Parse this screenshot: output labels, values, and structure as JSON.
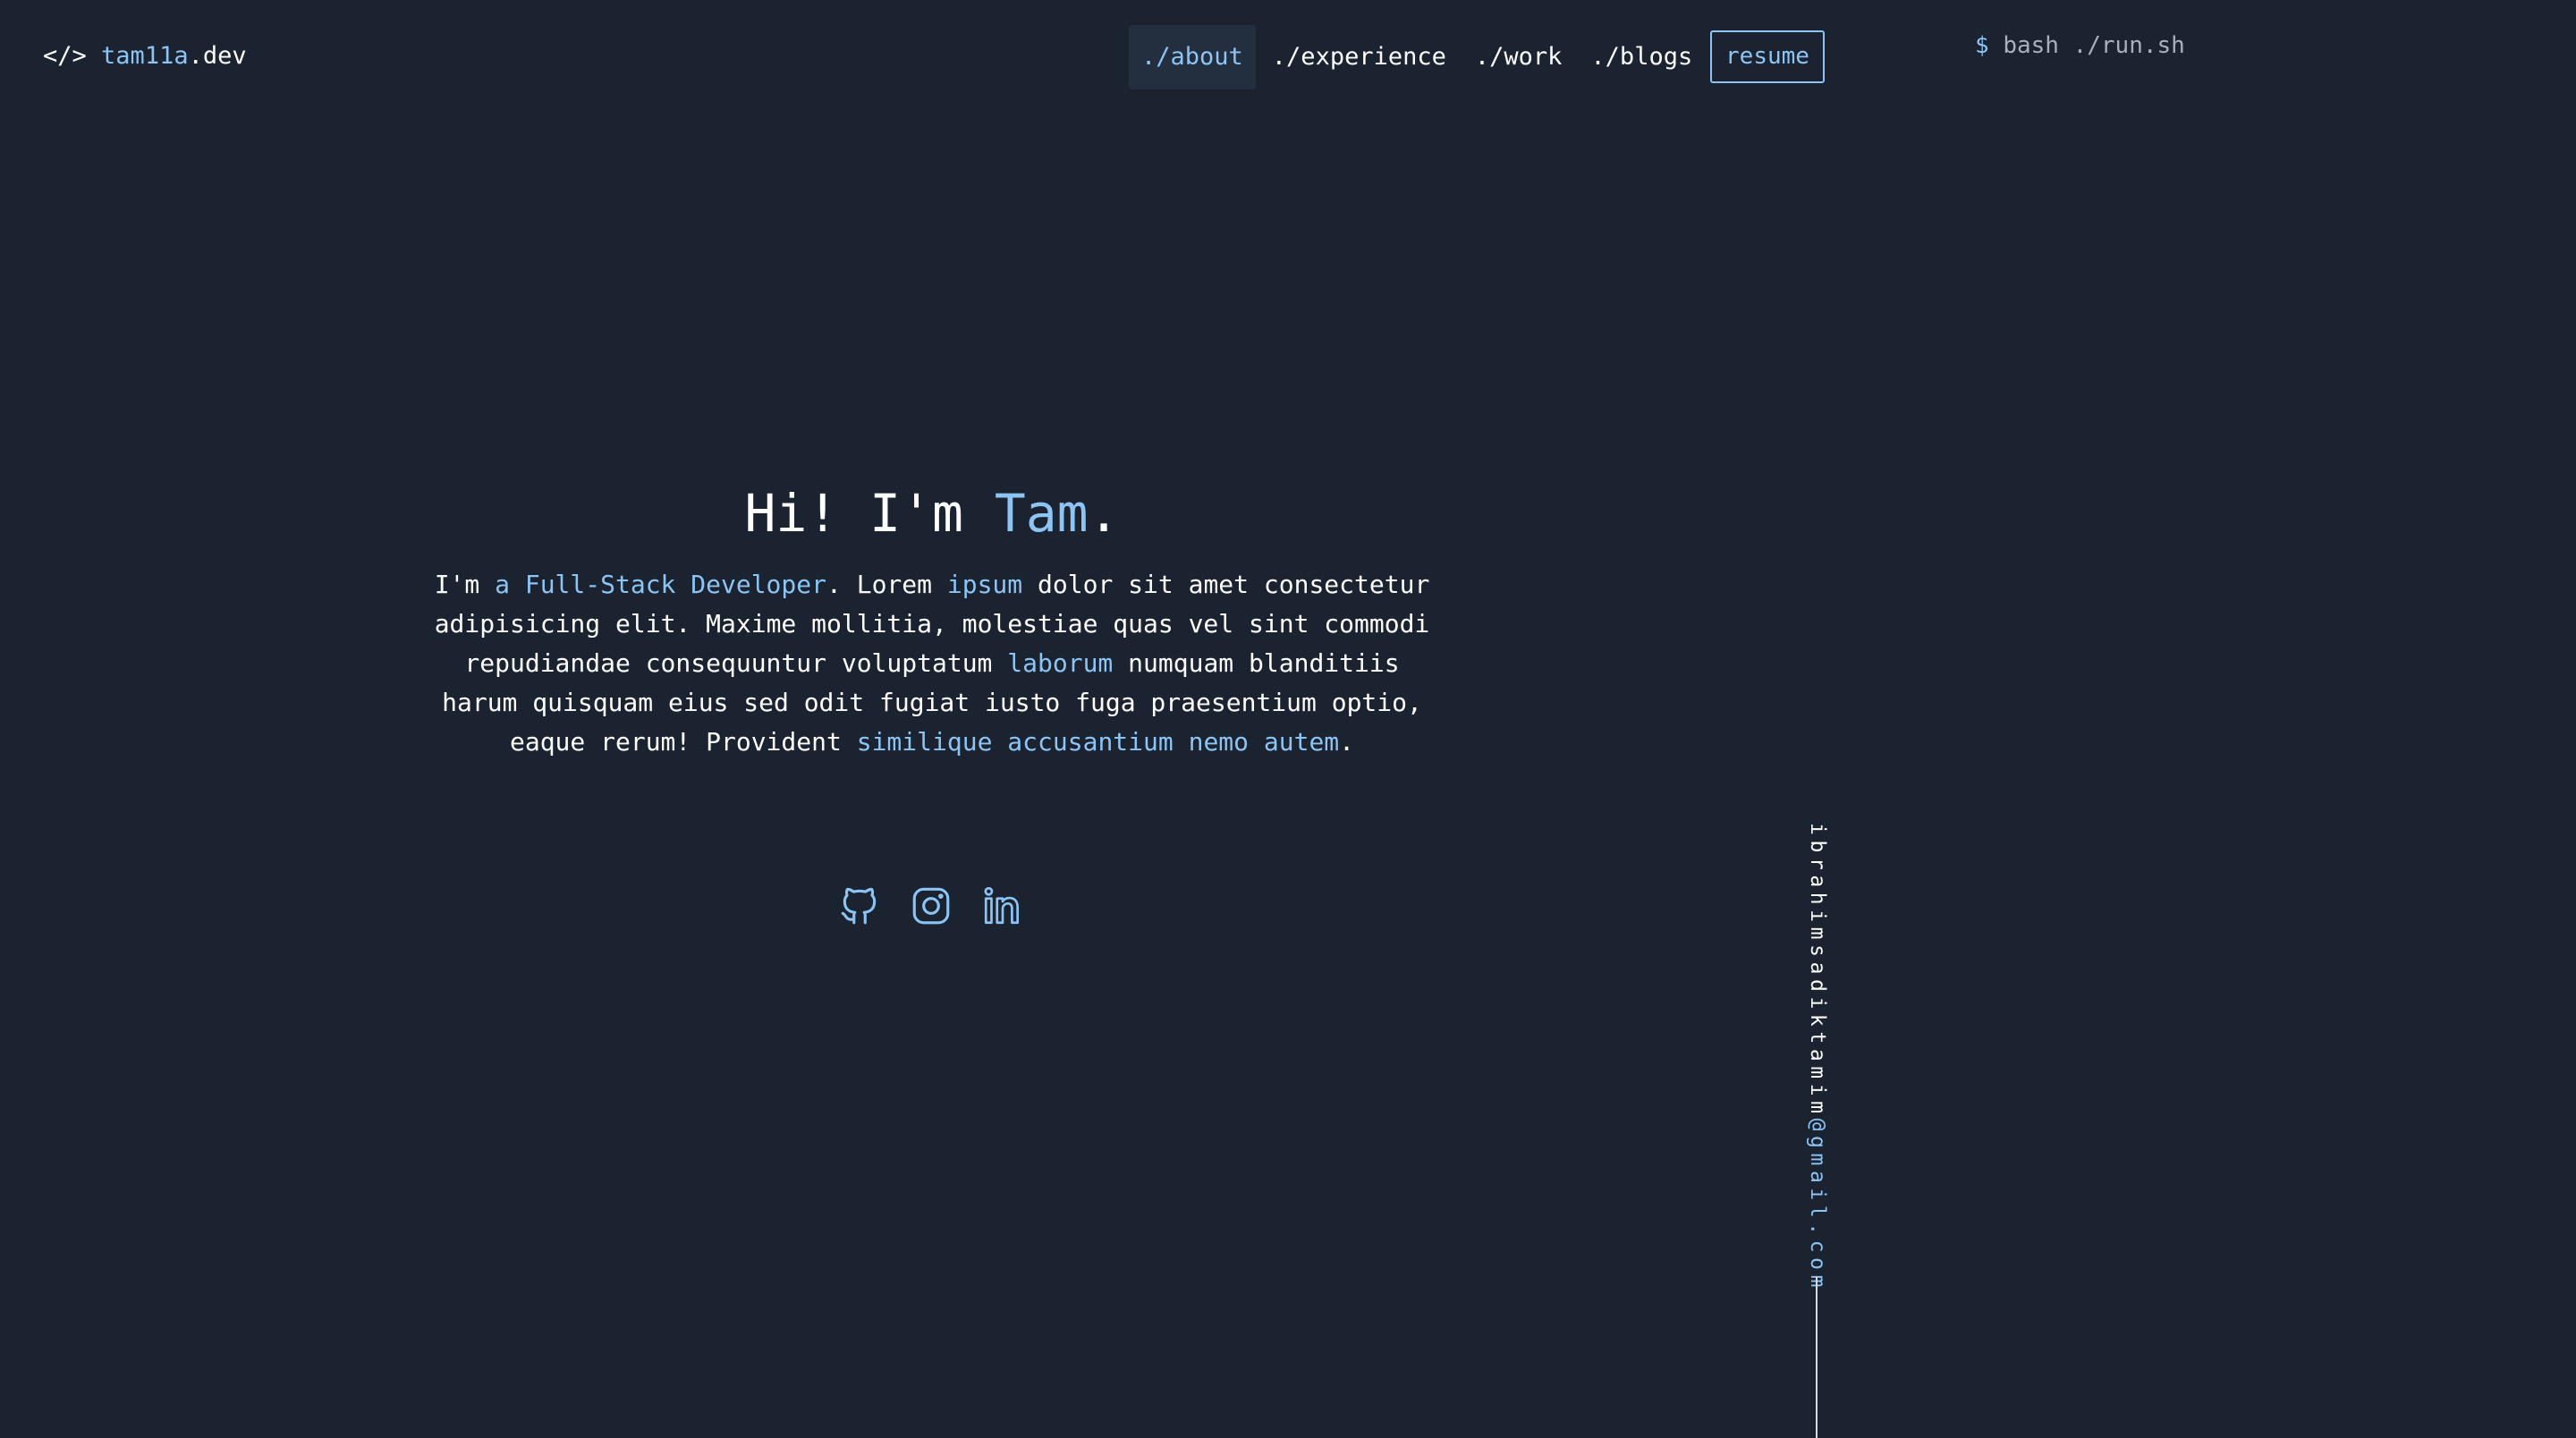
{
  "header": {
    "logo": {
      "bracket": "</>",
      "name": "tam11a",
      "suffix": ".dev"
    },
    "nav": [
      {
        "label": "./about",
        "active": true
      },
      {
        "label": "./experience",
        "active": false
      },
      {
        "label": "./work",
        "active": false
      },
      {
        "label": "./blogs",
        "active": false
      }
    ],
    "resume_label": "resume",
    "run": {
      "prompt": "$",
      "command": "bash ./run.sh"
    }
  },
  "hero": {
    "title_prefix": "Hi! I'm ",
    "title_name": "Tam",
    "title_suffix": ".",
    "bio": [
      {
        "text": "I'm ",
        "hl": false
      },
      {
        "text": "a Full-Stack Developer",
        "hl": true
      },
      {
        "text": ". Lorem ",
        "hl": false
      },
      {
        "text": "ipsum",
        "hl": true
      },
      {
        "text": " dolor sit amet consectetur adipisicing elit. Maxime mollitia, molestiae quas vel sint commodi repudiandae consequuntur voluptatum ",
        "hl": false
      },
      {
        "text": "laborum",
        "hl": true
      },
      {
        "text": " numquam blanditiis harum quisquam eius sed odit fugiat iusto fuga praesentium optio, eaque rerum! Provident ",
        "hl": false
      },
      {
        "text": "similique accusantium nemo autem",
        "hl": true
      },
      {
        "text": ".",
        "hl": false
      }
    ]
  },
  "socials": [
    {
      "name": "github-icon"
    },
    {
      "name": "instagram-icon"
    },
    {
      "name": "linkedin-icon"
    }
  ],
  "contact": {
    "email_user": "ibrahimsadiktamim",
    "email_domain": "@gmail.com"
  },
  "colors": {
    "background": "#1b2230",
    "accent": "#8cc4f4",
    "text": "#ffffff",
    "muted": "#a9b0bb",
    "active_nav_bg": "#232e3e"
  }
}
